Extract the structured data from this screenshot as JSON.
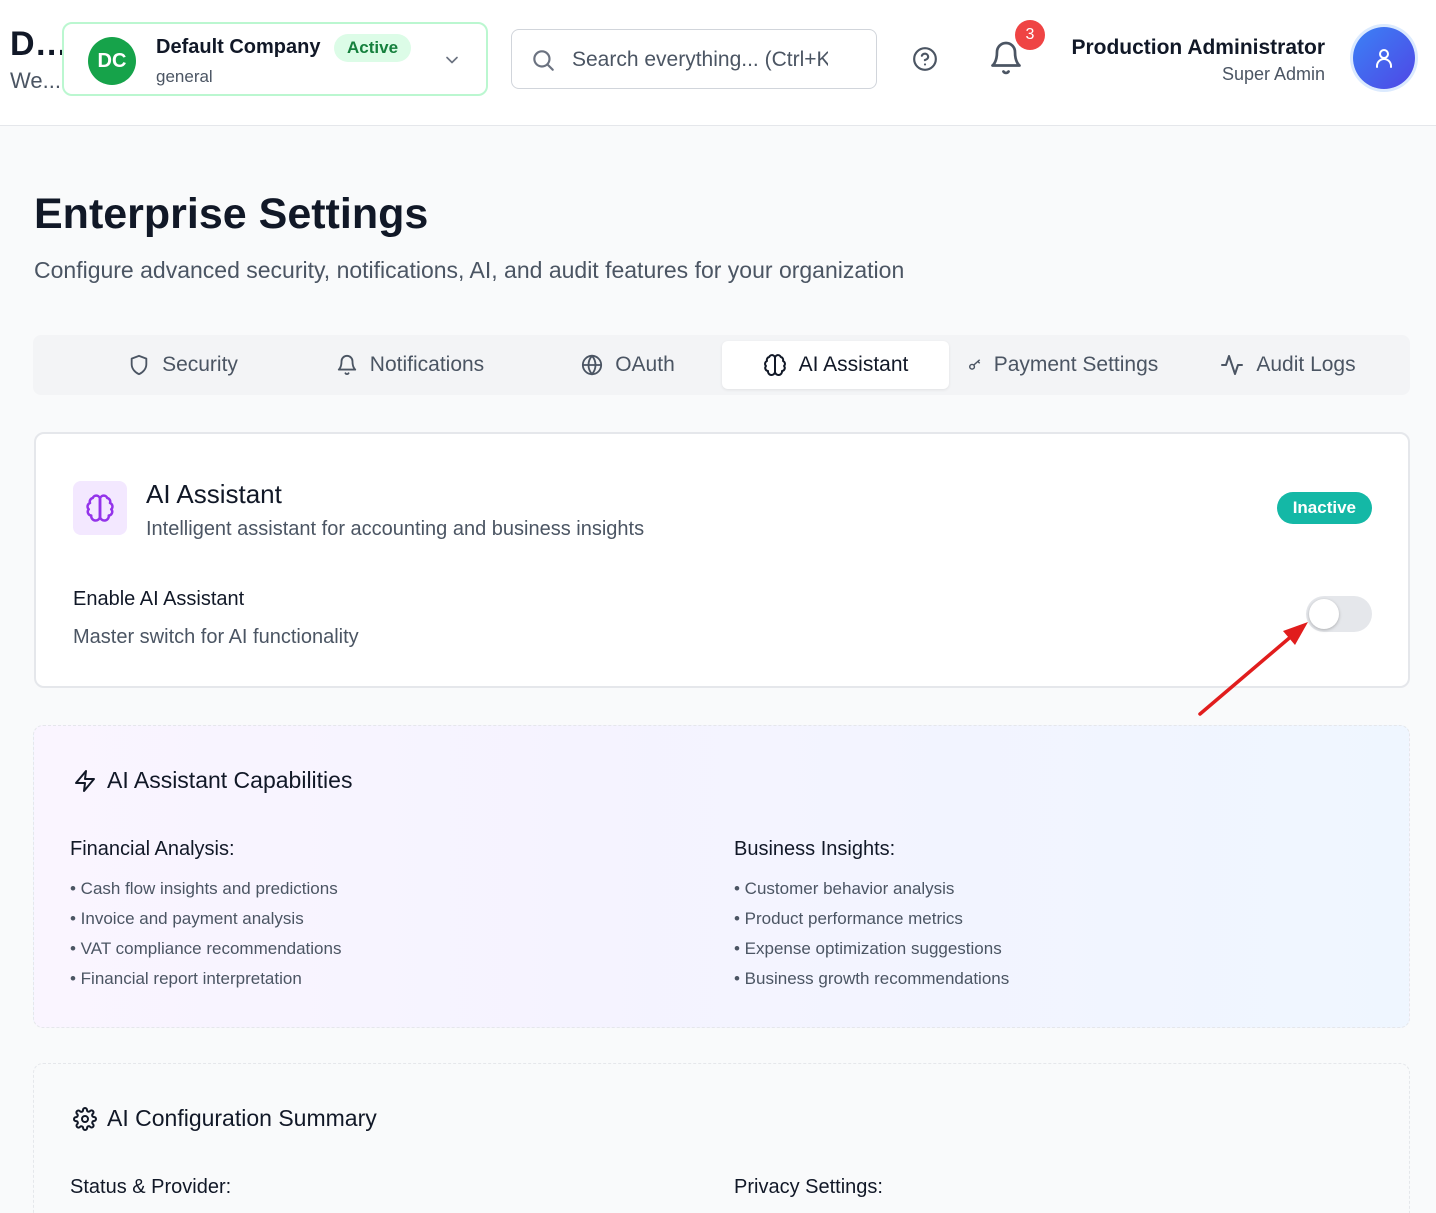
{
  "brand": {
    "title": "D...",
    "subtitle": "We..."
  },
  "company": {
    "initials": "DC",
    "name": "Default Company",
    "type": "general",
    "status": "Active"
  },
  "search": {
    "placeholder": "Search everything... (Ctrl+K)"
  },
  "notifications": {
    "count": "3"
  },
  "user": {
    "name": "Production Administrator",
    "role": "Super Admin"
  },
  "page": {
    "title": "Enterprise Settings",
    "subtitle": "Configure advanced security, notifications, AI, and audit features for your organization"
  },
  "tabs": [
    {
      "label": "Security",
      "icon": "shield-icon"
    },
    {
      "label": "Notifications",
      "icon": "bell-icon"
    },
    {
      "label": "OAuth",
      "icon": "globe-icon"
    },
    {
      "label": "AI Assistant",
      "icon": "brain-icon",
      "active": true
    },
    {
      "label": "Payment Settings",
      "icon": "key-icon"
    },
    {
      "label": "Audit Logs",
      "icon": "activity-icon"
    }
  ],
  "ai_card": {
    "title": "AI Assistant",
    "description": "Intelligent assistant for accounting and business insights",
    "status": "Inactive",
    "enable_label": "Enable AI Assistant",
    "enable_description": "Master switch for AI functionality",
    "enabled": false
  },
  "capabilities": {
    "title": "AI Assistant Capabilities",
    "financial": {
      "title": "Financial Analysis:",
      "items": [
        "• Cash flow insights and predictions",
        "• Invoice and payment analysis",
        "• VAT compliance recommendations",
        "• Financial report interpretation"
      ]
    },
    "business": {
      "title": "Business Insights:",
      "items": [
        "• Customer behavior analysis",
        "• Product performance metrics",
        "• Expense optimization suggestions",
        "• Business growth recommendations"
      ]
    }
  },
  "summary": {
    "title": "AI Configuration Summary",
    "status_title": "Status & Provider:",
    "privacy_title": "Privacy Settings:"
  },
  "colors": {
    "accent_green": "#16a34a",
    "inactive_teal": "#14b8a6",
    "brain_purple": "#9333ea",
    "arrow_red": "#e11d1d"
  }
}
